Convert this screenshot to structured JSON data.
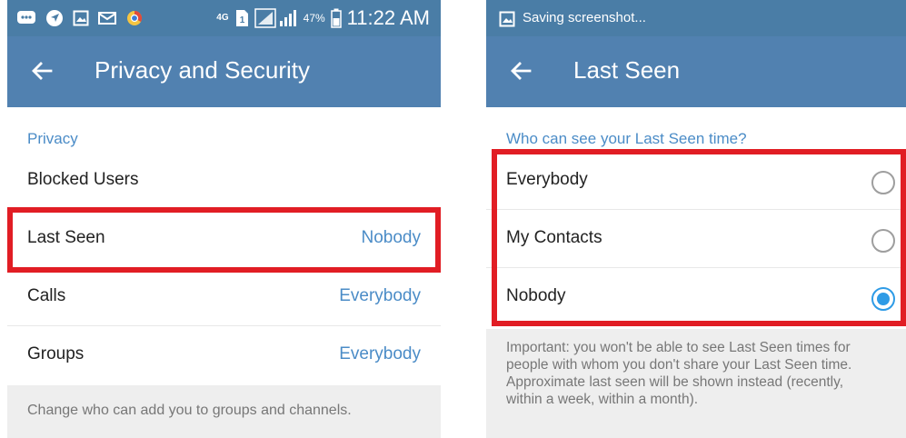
{
  "left": {
    "status_bar": {
      "time": "11:22 AM",
      "battery": "47%",
      "network": "4G",
      "icons": [
        "message-icon",
        "location-icon",
        "gallery-icon",
        "mail-icon",
        "chrome-icon",
        "sim-icon",
        "signal-icon",
        "battery-icon"
      ]
    },
    "title": "Privacy and Security",
    "section": "Privacy",
    "rows": [
      {
        "label": "Blocked Users",
        "value": ""
      },
      {
        "label": "Last Seen",
        "value": "Nobody"
      },
      {
        "label": "Calls",
        "value": "Everybody"
      },
      {
        "label": "Groups",
        "value": "Everybody"
      }
    ],
    "footer": "Change who can add you to groups and channels."
  },
  "right": {
    "status_bar": {
      "notification": "Saving screenshot..."
    },
    "title": "Last Seen",
    "question": "Who can see your Last Seen time?",
    "options": [
      {
        "label": "Everybody",
        "selected": false
      },
      {
        "label": "My Contacts",
        "selected": false
      },
      {
        "label": "Nobody",
        "selected": true
      }
    ],
    "note": "Important: you won't be able to see Last Seen times for people with whom you don't share your Last Seen time. Approximate last seen will be shown instead (recently, within a week, within a month)."
  },
  "colors": {
    "appbar": "#5181b0",
    "statusbar": "#4a7da6",
    "accent": "#4b8cc7",
    "highlight": "#e11d24",
    "radio_selected": "#2e9be6"
  }
}
